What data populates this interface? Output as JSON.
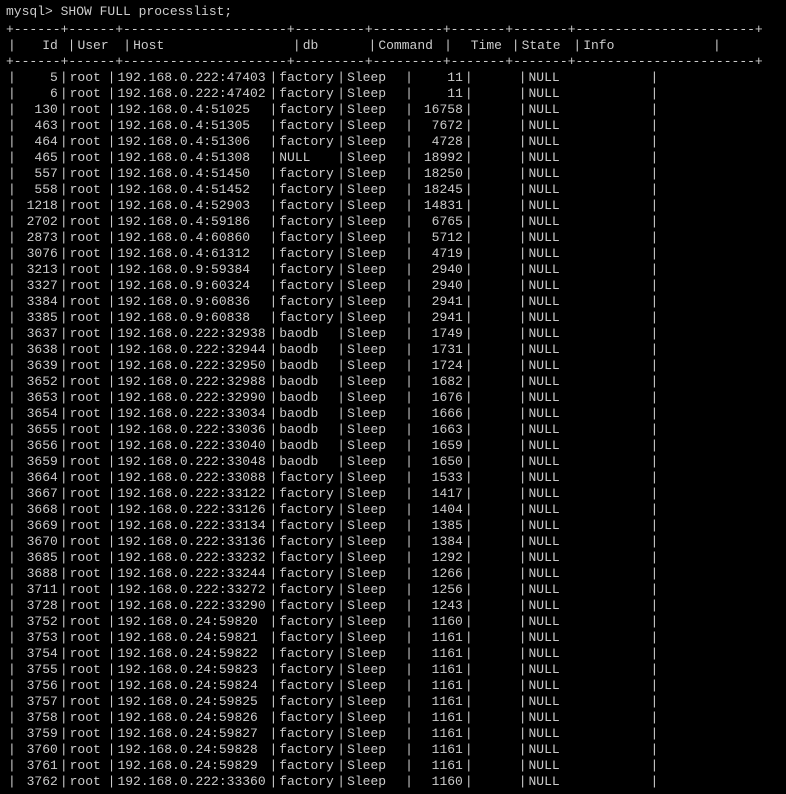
{
  "prompt": "mysql> SHOW FULL processlist;",
  "separator": "+------+------+---------------------+---------+---------+-------+-------+-----------------------+",
  "headers": {
    "id": "Id",
    "user": "User",
    "host": "Host",
    "db": "db",
    "command": "Command",
    "time": "Time",
    "state": "State",
    "info": "Info"
  },
  "rows": [
    {
      "id": "5",
      "user": "root",
      "host": "192.168.0.222:47403",
      "db": "factory",
      "command": "Sleep",
      "time": "11",
      "state": "",
      "info": "NULL"
    },
    {
      "id": "6",
      "user": "root",
      "host": "192.168.0.222:47402",
      "db": "factory",
      "command": "Sleep",
      "time": "11",
      "state": "",
      "info": "NULL"
    },
    {
      "id": "130",
      "user": "root",
      "host": "192.168.0.4:51025",
      "db": "factory",
      "command": "Sleep",
      "time": "16758",
      "state": "",
      "info": "NULL"
    },
    {
      "id": "463",
      "user": "root",
      "host": "192.168.0.4:51305",
      "db": "factory",
      "command": "Sleep",
      "time": "7672",
      "state": "",
      "info": "NULL"
    },
    {
      "id": "464",
      "user": "root",
      "host": "192.168.0.4:51306",
      "db": "factory",
      "command": "Sleep",
      "time": "4728",
      "state": "",
      "info": "NULL"
    },
    {
      "id": "465",
      "user": "root",
      "host": "192.168.0.4:51308",
      "db": "NULL",
      "command": "Sleep",
      "time": "18992",
      "state": "",
      "info": "NULL"
    },
    {
      "id": "557",
      "user": "root",
      "host": "192.168.0.4:51450",
      "db": "factory",
      "command": "Sleep",
      "time": "18250",
      "state": "",
      "info": "NULL"
    },
    {
      "id": "558",
      "user": "root",
      "host": "192.168.0.4:51452",
      "db": "factory",
      "command": "Sleep",
      "time": "18245",
      "state": "",
      "info": "NULL"
    },
    {
      "id": "1218",
      "user": "root",
      "host": "192.168.0.4:52903",
      "db": "factory",
      "command": "Sleep",
      "time": "14831",
      "state": "",
      "info": "NULL"
    },
    {
      "id": "2702",
      "user": "root",
      "host": "192.168.0.4:59186",
      "db": "factory",
      "command": "Sleep",
      "time": "6765",
      "state": "",
      "info": "NULL"
    },
    {
      "id": "2873",
      "user": "root",
      "host": "192.168.0.4:60860",
      "db": "factory",
      "command": "Sleep",
      "time": "5712",
      "state": "",
      "info": "NULL"
    },
    {
      "id": "3076",
      "user": "root",
      "host": "192.168.0.4:61312",
      "db": "factory",
      "command": "Sleep",
      "time": "4719",
      "state": "",
      "info": "NULL"
    },
    {
      "id": "3213",
      "user": "root",
      "host": "192.168.0.9:59384",
      "db": "factory",
      "command": "Sleep",
      "time": "2940",
      "state": "",
      "info": "NULL"
    },
    {
      "id": "3327",
      "user": "root",
      "host": "192.168.0.9:60324",
      "db": "factory",
      "command": "Sleep",
      "time": "2940",
      "state": "",
      "info": "NULL"
    },
    {
      "id": "3384",
      "user": "root",
      "host": "192.168.0.9:60836",
      "db": "factory",
      "command": "Sleep",
      "time": "2941",
      "state": "",
      "info": "NULL"
    },
    {
      "id": "3385",
      "user": "root",
      "host": "192.168.0.9:60838",
      "db": "factory",
      "command": "Sleep",
      "time": "2941",
      "state": "",
      "info": "NULL"
    },
    {
      "id": "3637",
      "user": "root",
      "host": "192.168.0.222:32938",
      "db": "baodb",
      "command": "Sleep",
      "time": "1749",
      "state": "",
      "info": "NULL"
    },
    {
      "id": "3638",
      "user": "root",
      "host": "192.168.0.222:32944",
      "db": "baodb",
      "command": "Sleep",
      "time": "1731",
      "state": "",
      "info": "NULL"
    },
    {
      "id": "3639",
      "user": "root",
      "host": "192.168.0.222:32950",
      "db": "baodb",
      "command": "Sleep",
      "time": "1724",
      "state": "",
      "info": "NULL"
    },
    {
      "id": "3652",
      "user": "root",
      "host": "192.168.0.222:32988",
      "db": "baodb",
      "command": "Sleep",
      "time": "1682",
      "state": "",
      "info": "NULL"
    },
    {
      "id": "3653",
      "user": "root",
      "host": "192.168.0.222:32990",
      "db": "baodb",
      "command": "Sleep",
      "time": "1676",
      "state": "",
      "info": "NULL"
    },
    {
      "id": "3654",
      "user": "root",
      "host": "192.168.0.222:33034",
      "db": "baodb",
      "command": "Sleep",
      "time": "1666",
      "state": "",
      "info": "NULL"
    },
    {
      "id": "3655",
      "user": "root",
      "host": "192.168.0.222:33036",
      "db": "baodb",
      "command": "Sleep",
      "time": "1663",
      "state": "",
      "info": "NULL"
    },
    {
      "id": "3656",
      "user": "root",
      "host": "192.168.0.222:33040",
      "db": "baodb",
      "command": "Sleep",
      "time": "1659",
      "state": "",
      "info": "NULL"
    },
    {
      "id": "3659",
      "user": "root",
      "host": "192.168.0.222:33048",
      "db": "baodb",
      "command": "Sleep",
      "time": "1650",
      "state": "",
      "info": "NULL"
    },
    {
      "id": "3664",
      "user": "root",
      "host": "192.168.0.222:33088",
      "db": "factory",
      "command": "Sleep",
      "time": "1533",
      "state": "",
      "info": "NULL"
    },
    {
      "id": "3667",
      "user": "root",
      "host": "192.168.0.222:33122",
      "db": "factory",
      "command": "Sleep",
      "time": "1417",
      "state": "",
      "info": "NULL"
    },
    {
      "id": "3668",
      "user": "root",
      "host": "192.168.0.222:33126",
      "db": "factory",
      "command": "Sleep",
      "time": "1404",
      "state": "",
      "info": "NULL"
    },
    {
      "id": "3669",
      "user": "root",
      "host": "192.168.0.222:33134",
      "db": "factory",
      "command": "Sleep",
      "time": "1385",
      "state": "",
      "info": "NULL"
    },
    {
      "id": "3670",
      "user": "root",
      "host": "192.168.0.222:33136",
      "db": "factory",
      "command": "Sleep",
      "time": "1384",
      "state": "",
      "info": "NULL"
    },
    {
      "id": "3685",
      "user": "root",
      "host": "192.168.0.222:33232",
      "db": "factory",
      "command": "Sleep",
      "time": "1292",
      "state": "",
      "info": "NULL"
    },
    {
      "id": "3688",
      "user": "root",
      "host": "192.168.0.222:33244",
      "db": "factory",
      "command": "Sleep",
      "time": "1266",
      "state": "",
      "info": "NULL"
    },
    {
      "id": "3711",
      "user": "root",
      "host": "192.168.0.222:33272",
      "db": "factory",
      "command": "Sleep",
      "time": "1256",
      "state": "",
      "info": "NULL"
    },
    {
      "id": "3728",
      "user": "root",
      "host": "192.168.0.222:33290",
      "db": "factory",
      "command": "Sleep",
      "time": "1243",
      "state": "",
      "info": "NULL"
    },
    {
      "id": "3752",
      "user": "root",
      "host": "192.168.0.24:59820",
      "db": "factory",
      "command": "Sleep",
      "time": "1160",
      "state": "",
      "info": "NULL"
    },
    {
      "id": "3753",
      "user": "root",
      "host": "192.168.0.24:59821",
      "db": "factory",
      "command": "Sleep",
      "time": "1161",
      "state": "",
      "info": "NULL"
    },
    {
      "id": "3754",
      "user": "root",
      "host": "192.168.0.24:59822",
      "db": "factory",
      "command": "Sleep",
      "time": "1161",
      "state": "",
      "info": "NULL"
    },
    {
      "id": "3755",
      "user": "root",
      "host": "192.168.0.24:59823",
      "db": "factory",
      "command": "Sleep",
      "time": "1161",
      "state": "",
      "info": "NULL"
    },
    {
      "id": "3756",
      "user": "root",
      "host": "192.168.0.24:59824",
      "db": "factory",
      "command": "Sleep",
      "time": "1161",
      "state": "",
      "info": "NULL"
    },
    {
      "id": "3757",
      "user": "root",
      "host": "192.168.0.24:59825",
      "db": "factory",
      "command": "Sleep",
      "time": "1161",
      "state": "",
      "info": "NULL"
    },
    {
      "id": "3758",
      "user": "root",
      "host": "192.168.0.24:59826",
      "db": "factory",
      "command": "Sleep",
      "time": "1161",
      "state": "",
      "info": "NULL"
    },
    {
      "id": "3759",
      "user": "root",
      "host": "192.168.0.24:59827",
      "db": "factory",
      "command": "Sleep",
      "time": "1161",
      "state": "",
      "info": "NULL"
    },
    {
      "id": "3760",
      "user": "root",
      "host": "192.168.0.24:59828",
      "db": "factory",
      "command": "Sleep",
      "time": "1161",
      "state": "",
      "info": "NULL"
    },
    {
      "id": "3761",
      "user": "root",
      "host": "192.168.0.24:59829",
      "db": "factory",
      "command": "Sleep",
      "time": "1161",
      "state": "",
      "info": "NULL"
    },
    {
      "id": "3762",
      "user": "root",
      "host": "192.168.0.222:33360",
      "db": "factory",
      "command": "Sleep",
      "time": "1160",
      "state": "",
      "info": "NULL"
    }
  ]
}
